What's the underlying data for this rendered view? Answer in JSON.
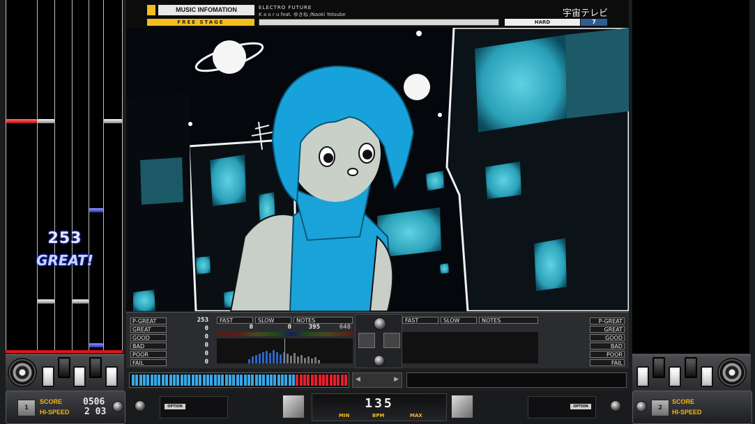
{
  "header": {
    "info_label": "MUSIC INFOMATION",
    "genre": "ELECTRO FUTURE",
    "artist": "K a o r u  feat. ゆきね /Naoki Yotsube",
    "title": "宇宙テレビ",
    "stage": "FREE STAGE",
    "difficulty": "HARD",
    "level": "7"
  },
  "p1_lane": {
    "combo": "253",
    "judge": "GREAT!"
  },
  "stats": {
    "judgments": [
      {
        "label": "P-GREAT",
        "value": "253"
      },
      {
        "label": "GREAT",
        "value": "0"
      },
      {
        "label": "GOOD",
        "value": "0"
      },
      {
        "label": "BAD",
        "value": "0"
      },
      {
        "label": "POOR",
        "value": "0"
      },
      {
        "label": "FAIL",
        "value": "0"
      }
    ],
    "p1_headers": {
      "fast": "FAST",
      "slow": "SLOW",
      "notes": "NOTES"
    },
    "p1_values": {
      "fast": "0",
      "slow": "0",
      "notes": "395",
      "total": "648"
    },
    "p2_headers": {
      "fast": "FAST",
      "slow": "SLOW",
      "notes": "NOTES"
    },
    "p2_judgments": [
      "P-GREAT",
      "GREAT",
      "GOOD",
      "BAD",
      "POOR",
      "FAIL"
    ]
  },
  "gauge": {
    "filled_segments_blue": 44,
    "filled_segments_red": 14,
    "total_segments": 58
  },
  "bpm": {
    "value": "135",
    "min_label": "MIN",
    "bpm_label": "BPM",
    "max_label": "MAX"
  },
  "p1_panel": {
    "score_label": "SCORE",
    "score": "0506",
    "hispeed_label": "HI-SPEED",
    "hispeed": "2 03",
    "player": "1"
  },
  "p2_panel": {
    "score_label": "SCORE",
    "hispeed_label": "HI-SPEED",
    "player": "2"
  },
  "option_label": "OPTION",
  "colors": {
    "accent_yellow": "#f3bd1d",
    "gauge_blue": "#38a8e8",
    "gauge_red": "#e5202c",
    "hard_level_blue": "#2f5c92"
  }
}
